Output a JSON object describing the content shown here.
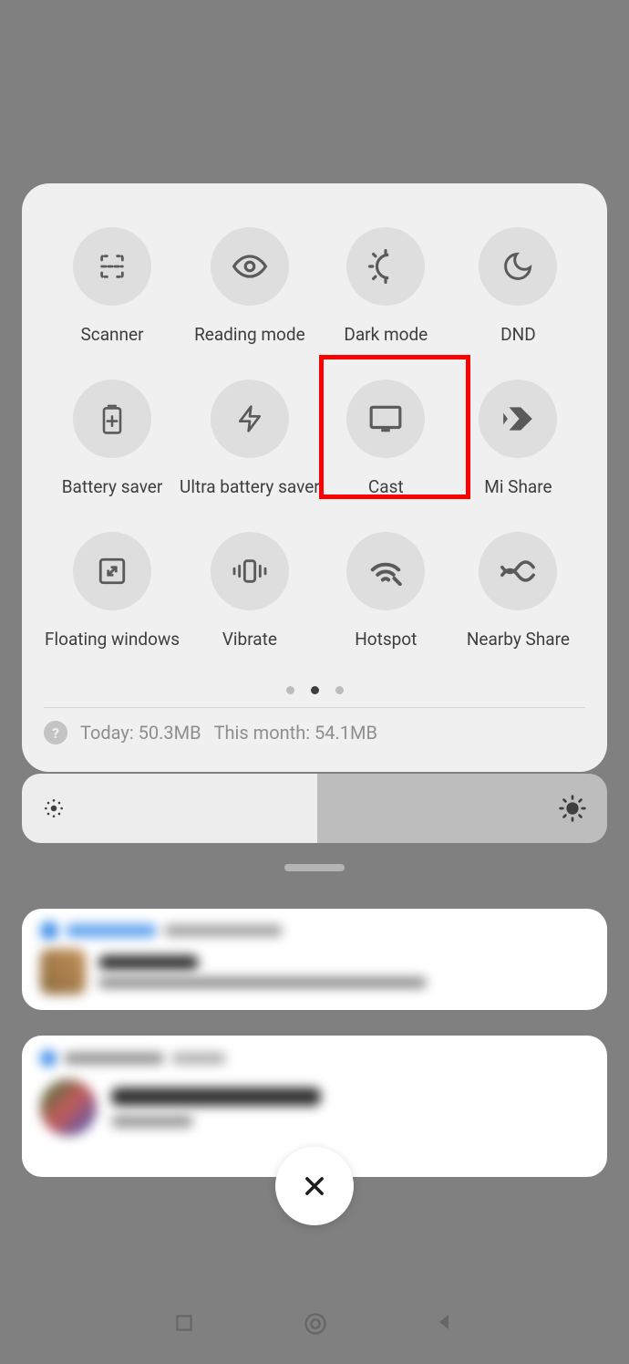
{
  "tiles": [
    {
      "name": "scanner",
      "label": "Scanner"
    },
    {
      "name": "reading-mode",
      "label": "Reading mode"
    },
    {
      "name": "dark-mode",
      "label": "Dark mode"
    },
    {
      "name": "dnd",
      "label": "DND"
    },
    {
      "name": "battery-saver",
      "label": "Battery saver"
    },
    {
      "name": "ultra-battery-saver",
      "label": "Ultra battery saver"
    },
    {
      "name": "cast",
      "label": "Cast",
      "highlighted": true
    },
    {
      "name": "mi-share",
      "label": "Mi Share"
    },
    {
      "name": "floating-windows",
      "label": "Floating windows"
    },
    {
      "name": "vibrate",
      "label": "Vibrate"
    },
    {
      "name": "hotspot",
      "label": "Hotspot"
    },
    {
      "name": "nearby-share",
      "label": "Nearby Share"
    }
  ],
  "pagination": {
    "total": 3,
    "active": 1
  },
  "data_usage": {
    "today_label": "Today: 50.3MB",
    "month_label": "This month: 54.1MB"
  },
  "brightness": {
    "percent": 50
  },
  "close_label": "Close",
  "highlight_index": 6
}
